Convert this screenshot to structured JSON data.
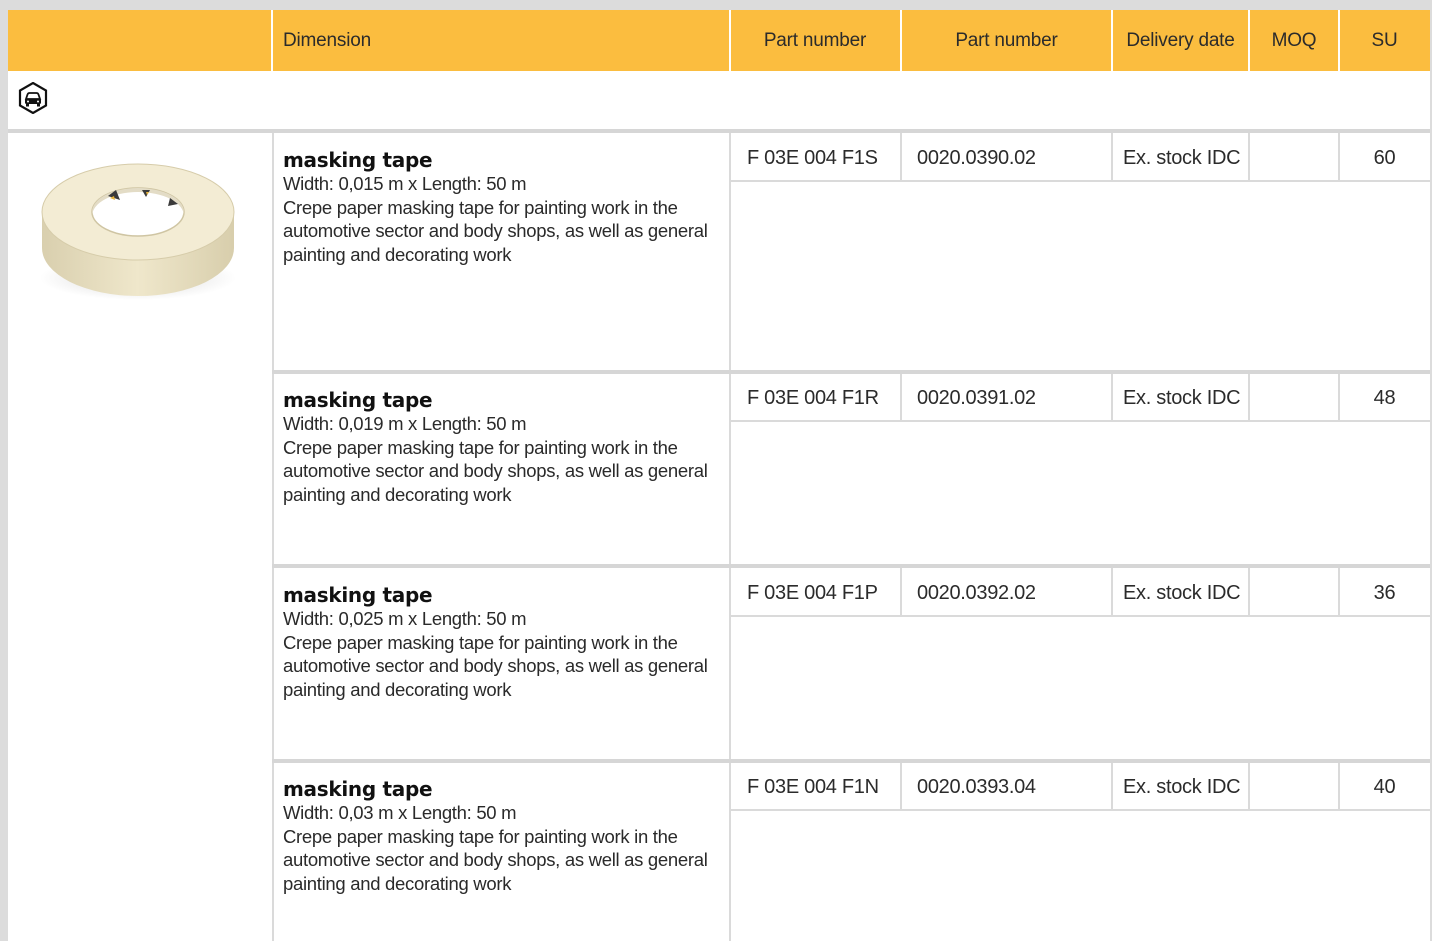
{
  "header": {
    "col_dimension": "Dimension",
    "col_part_number_1": "Part number",
    "col_part_number_2": "Part number",
    "col_delivery_date": "Delivery date",
    "col_moq": "MOQ",
    "col_su": "SU"
  },
  "category_icon": "car-paint-shield-icon",
  "colors": {
    "header_bg": "#fbbd3f",
    "page_bg": "#dcdcdc",
    "grid": "#dadada"
  },
  "products": [
    {
      "name": "masking tape",
      "dimension": "Width: 0,015 m x Length: 50 m",
      "description": "Crepe paper masking tape for painting work in the automotive sector and body shops, as well as general painting and decorating work",
      "part_number_1": "F 03E 004 F1S",
      "part_number_2": "0020.0390.02",
      "delivery_date": "Ex. stock IDC",
      "moq": "",
      "su": "60"
    },
    {
      "name": "masking tape",
      "dimension": "Width: 0,019 m x Length: 50 m",
      "description": "Crepe paper masking tape for painting work in the automotive sector and body shops, as well as general painting and decorating work",
      "part_number_1": "F 03E 004 F1R",
      "part_number_2": "0020.0391.02",
      "delivery_date": "Ex. stock IDC",
      "moq": "",
      "su": "48"
    },
    {
      "name": "masking tape",
      "dimension": "Width: 0,025 m x Length: 50 m",
      "description": "Crepe paper masking tape for painting work in the automotive sector and body shops, as well as general painting and decorating work",
      "part_number_1": "F 03E 004 F1P",
      "part_number_2": "0020.0392.02",
      "delivery_date": "Ex. stock IDC",
      "moq": "",
      "su": "36"
    },
    {
      "name": "masking tape",
      "dimension": "Width: 0,03 m x Length: 50 m",
      "description": "Crepe paper masking tape for painting work in the automotive sector and body shops, as well as general painting and decorating work",
      "part_number_1": "F 03E 004 F1N",
      "part_number_2": "0020.0393.04",
      "delivery_date": "Ex. stock IDC",
      "moq": "",
      "su": "40"
    }
  ]
}
